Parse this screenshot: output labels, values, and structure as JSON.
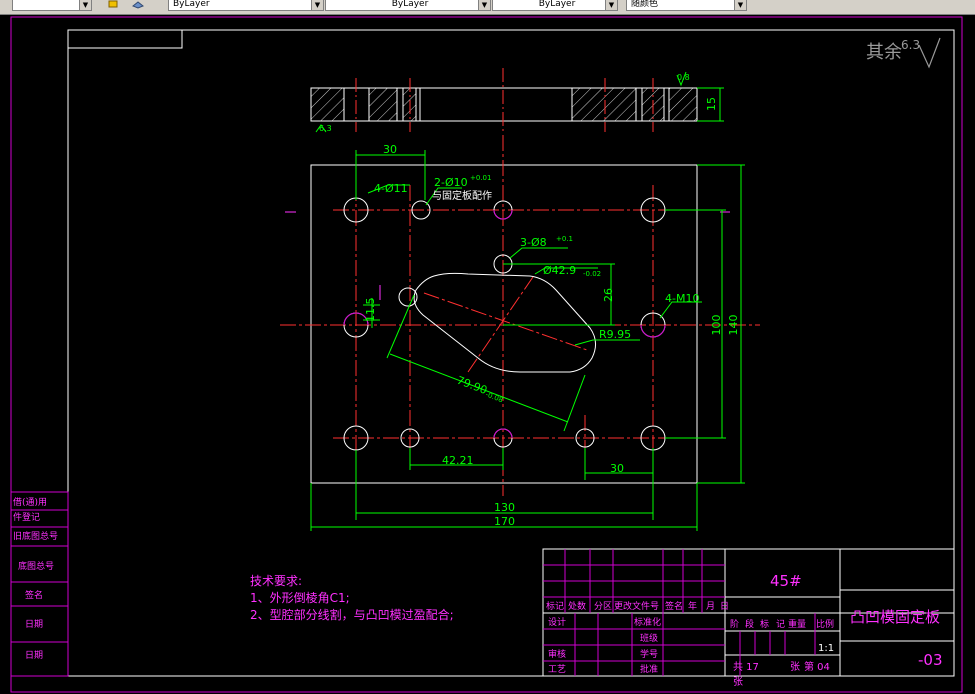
{
  "toolbar": {
    "layer_combo_1": "ByLayer",
    "layer_combo_2": "ByLayer",
    "layer_combo_3": "ByLayer",
    "plot_style": "随颜色"
  },
  "drawing": {
    "roughness_label": "其余",
    "roughness_value": "6.3",
    "dims": {
      "top_30": "30",
      "hole_4x11": "4-Ø11",
      "hole_2x10_main": "2-Ø10",
      "hole_2x10_tol": "+0.01",
      "hole_2x10_note": "与固定板配作",
      "hole_3x8_main": "3-Ø8",
      "hole_3x8_tol": "+0.1",
      "dia_42_main": "Ø42.9",
      "dia_42_tol": "-0.02",
      "dim_26": "26",
      "m10": "4-M10",
      "dim_115": "11.5",
      "r995": "R9.95",
      "dim_7990_main": "79.90",
      "dim_7990_tol": "-0.08",
      "dim_100": "100",
      "dim_140": "140",
      "dim_4221": "42.21",
      "dim_30_bottom": "30",
      "dim_130": "130",
      "dim_170": "170",
      "dim_15": "15",
      "rough_top": "0.8",
      "rough_sec": "6.3"
    },
    "tech": {
      "heading": "技术要求:",
      "item1": "1、外形倒棱角C1;",
      "item2": "2、型腔部分线割，与凸凹模过盈配合;"
    },
    "left_block": {
      "r1": "借(通)用",
      "r2": "件登记",
      "r3": "旧底图总号",
      "r4": "底图总号",
      "r5": "签名",
      "r6": "日期",
      "r7": "日期"
    },
    "title_block": {
      "material": "45#",
      "name": "凸凹模固定板",
      "code": "-03",
      "rev_row": [
        "标记",
        "处数",
        "分区",
        "更改文件号",
        "签名",
        "年",
        "月",
        "日"
      ],
      "design": "设计",
      "standard": "标准化",
      "class": "班级",
      "review": "审核",
      "student_no": "学号",
      "process": "工艺",
      "approve": "批准",
      "stage_row": [
        "阶",
        "段",
        "标",
        "记",
        "重量",
        "比例"
      ],
      "scale": "1:1",
      "total": "共 17",
      "sheets": "张",
      "page": "第 04",
      "page_unit": "张"
    }
  }
}
